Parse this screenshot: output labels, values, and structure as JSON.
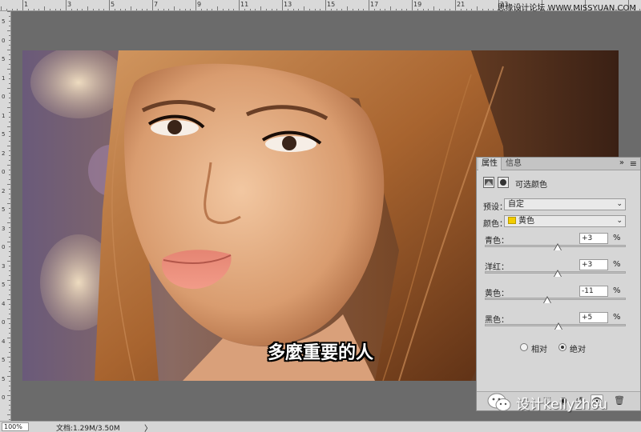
{
  "ruler": {
    "top_labels": [
      "1",
      "3",
      "5",
      "7",
      "9",
      "11",
      "13",
      "15",
      "17",
      "19",
      "21",
      "23"
    ],
    "left_labels": [
      "5",
      "0",
      "5",
      "1",
      "0",
      "1",
      "5",
      "2",
      "0",
      "2",
      "5",
      "3",
      "0",
      "3",
      "5",
      "4",
      "0",
      "4",
      "5",
      "5",
      "0"
    ]
  },
  "watermark_top": "思缘设计论坛 WWW.MISSYUAN.COM",
  "canvas": {
    "subtitle": "多麼重要的人"
  },
  "status_bar": {
    "zoom": "100%",
    "doc_info": "文档:1.29M/3.50M",
    "arrow": "〉"
  },
  "panel": {
    "tabs": [
      {
        "label": "属性"
      },
      {
        "label": "信息"
      }
    ],
    "collapse_glyph": "»",
    "menu_glyph": "≡",
    "adjustment_title": "可选颜色",
    "preset_label": "预设：",
    "preset_value": "自定",
    "color_label": "颜色：",
    "color_value": "黄色",
    "color_swatch": "#f2cc00",
    "sliders": [
      {
        "label": "青色：",
        "value": "+3",
        "pct": "%",
        "level": 3
      },
      {
        "label": "洋红：",
        "value": "+3",
        "pct": "%",
        "level": 3
      },
      {
        "label": "黄色：",
        "value": "-11",
        "pct": "%",
        "level": -11
      },
      {
        "label": "黑色：",
        "value": "+5",
        "pct": "%",
        "level": 5
      }
    ],
    "method_relative": "相对",
    "method_absolute": "绝对",
    "method_selected": "absolute"
  },
  "wechat_watermark": "设计kellyzhou"
}
